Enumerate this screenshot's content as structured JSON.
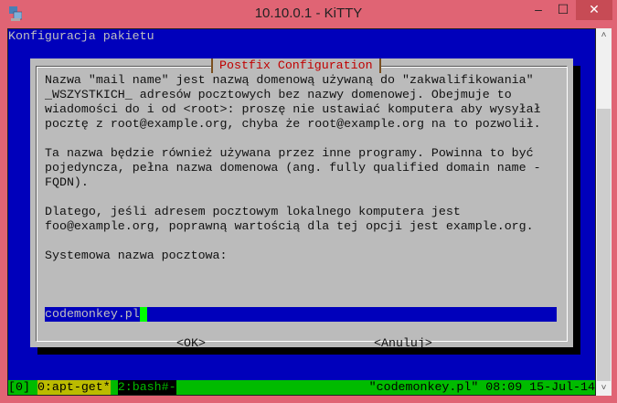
{
  "window": {
    "title": "10.10.0.1 - KiTTY",
    "minimize": "‒",
    "maximize": "☐",
    "close": "✕"
  },
  "terminal": {
    "header": "Konfiguracja pakietu",
    "dialog": {
      "title": "Postfix Configuration",
      "lines": [
        "Nazwa \"mail name\" jest nazwą domenową używaną do \"zakwalifikowania\"",
        "_WSZYSTKICH_ adresów pocztowych bez nazwy domenowej. Obejmuje to",
        "wiadomości do i od <root>: proszę nie ustawiać komputera aby wysyłał",
        "pocztę z root@example.org, chyba że root@example.org na to pozwolił.",
        "",
        "Ta nazwa będzie również używana przez inne programy. Powinna to być",
        "pojedyncza, pełna nazwa domenowa (ang. fully qualified domain name -",
        "FQDN).",
        "",
        "Dlatego, jeśli adresem pocztowym lokalnego komputera jest",
        "foo@example.org, poprawną wartością dla tej opcji jest example.org.",
        "",
        "Systemowa nazwa pocztowa:"
      ],
      "input_value": "codemonkey.pl",
      "ok_label": "<OK>",
      "cancel_label": "<Anuluj>"
    },
    "status": {
      "session": "[0]",
      "win0": "0:apt-get*",
      "win2": "2:bash#-",
      "right": "\"codemonkey.pl\" 08:09 15-Jul-14"
    }
  },
  "scrollbar": {
    "up": "˄",
    "down": "˅"
  }
}
